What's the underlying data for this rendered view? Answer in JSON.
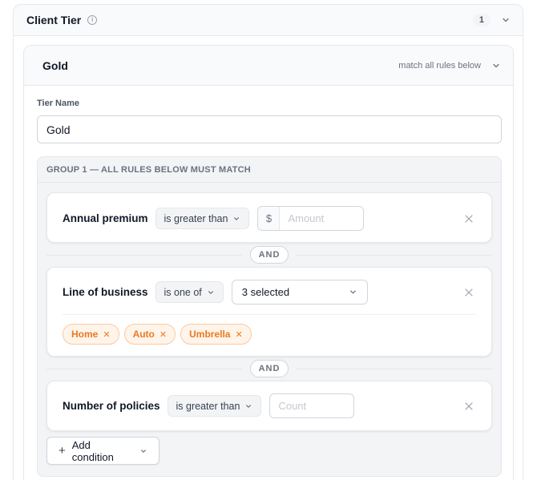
{
  "section": {
    "title": "Client Tier",
    "count": "1"
  },
  "tier": {
    "name": "Gold",
    "match_mode": "match all rules below",
    "name_field_label": "Tier Name",
    "name_value": "Gold"
  },
  "group": {
    "header": "GROUP 1 — ALL RULES BELOW MUST MATCH",
    "connector": "AND",
    "rules": [
      {
        "label": "Annual premium",
        "operator": "is greater than",
        "currency": "$",
        "placeholder": "Amount"
      },
      {
        "label": "Line of business",
        "operator": "is one of",
        "selection": "3 selected",
        "chips": [
          "Home",
          "Auto",
          "Umbrella"
        ]
      },
      {
        "label": "Number of policies",
        "operator": "is greater than",
        "placeholder": "Count"
      }
    ],
    "add_label": "Add condition"
  },
  "icons": {
    "info": "info-icon",
    "chevron": "chevron-down-icon",
    "remove": "close-icon",
    "add": "plus-icon"
  },
  "colors": {
    "chip_text": "#ea7a21",
    "chip_bg": "#fff4ea",
    "chip_border": "#fbc99d"
  }
}
